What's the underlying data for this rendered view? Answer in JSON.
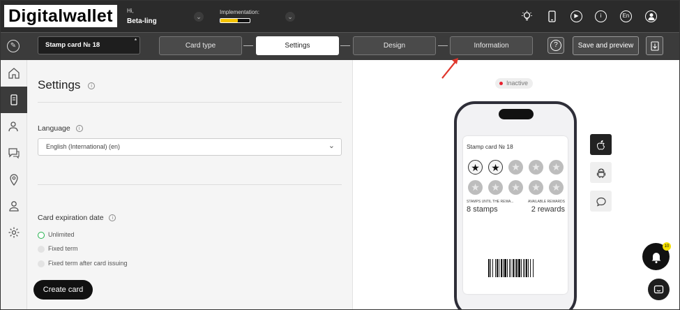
{
  "app": {
    "logo": "Digitalwallet"
  },
  "user": {
    "greeting": "Hi,",
    "name": "Beta-ling"
  },
  "implementation": {
    "label": "Implementation:",
    "progress": 0.6
  },
  "topbar_icons": [
    "lightbulb-icon",
    "phone-icon",
    "play-icon",
    "info-icon",
    "language-icon",
    "avatar"
  ],
  "topbar_language": "En",
  "card": {
    "name": "Stamp card № 18",
    "required_mark": "*"
  },
  "steps": [
    {
      "label": "Card type",
      "active": false
    },
    {
      "label": "Settings",
      "active": true
    },
    {
      "label": "Design",
      "active": false
    },
    {
      "label": "Information",
      "active": false
    }
  ],
  "actions": {
    "help": "?",
    "save": "Save and preview",
    "download_icon": "download-icon"
  },
  "sidebar": [
    "home-icon",
    "card-icon",
    "users-icon",
    "chat-icon",
    "location-icon",
    "user-settings-icon",
    "gear-icon"
  ],
  "settings": {
    "title": "Settings",
    "language_label": "Language",
    "language_value": "English (International) (en)",
    "expiration_label": "Card expiration date",
    "options": [
      {
        "label": "Unlimited",
        "selected": true
      },
      {
        "label": "Fixed term",
        "selected": false
      },
      {
        "label": "Fixed term after card issuing",
        "selected": false
      }
    ],
    "create_button": "Create card"
  },
  "preview": {
    "status": "Inactive",
    "status_color": "#e8212f",
    "pass_title": "Stamp card № 18",
    "stamps_total": 10,
    "stamps_filled": 2,
    "left_caption": "STAMPS UNTIL THE REWA...",
    "left_value": "8 stamps",
    "right_caption": "AVAILABLE REWARDS",
    "right_value": "2 rewards"
  },
  "platforms": [
    {
      "name": "apple-icon",
      "active": true
    },
    {
      "name": "android-icon",
      "active": false
    },
    {
      "name": "message-icon",
      "active": false
    }
  ],
  "notifications": {
    "count": "10"
  },
  "colors": {
    "accent_yellow": "#f5c400",
    "selected_radio": "#22b14c",
    "arrow": "#e0362c"
  }
}
